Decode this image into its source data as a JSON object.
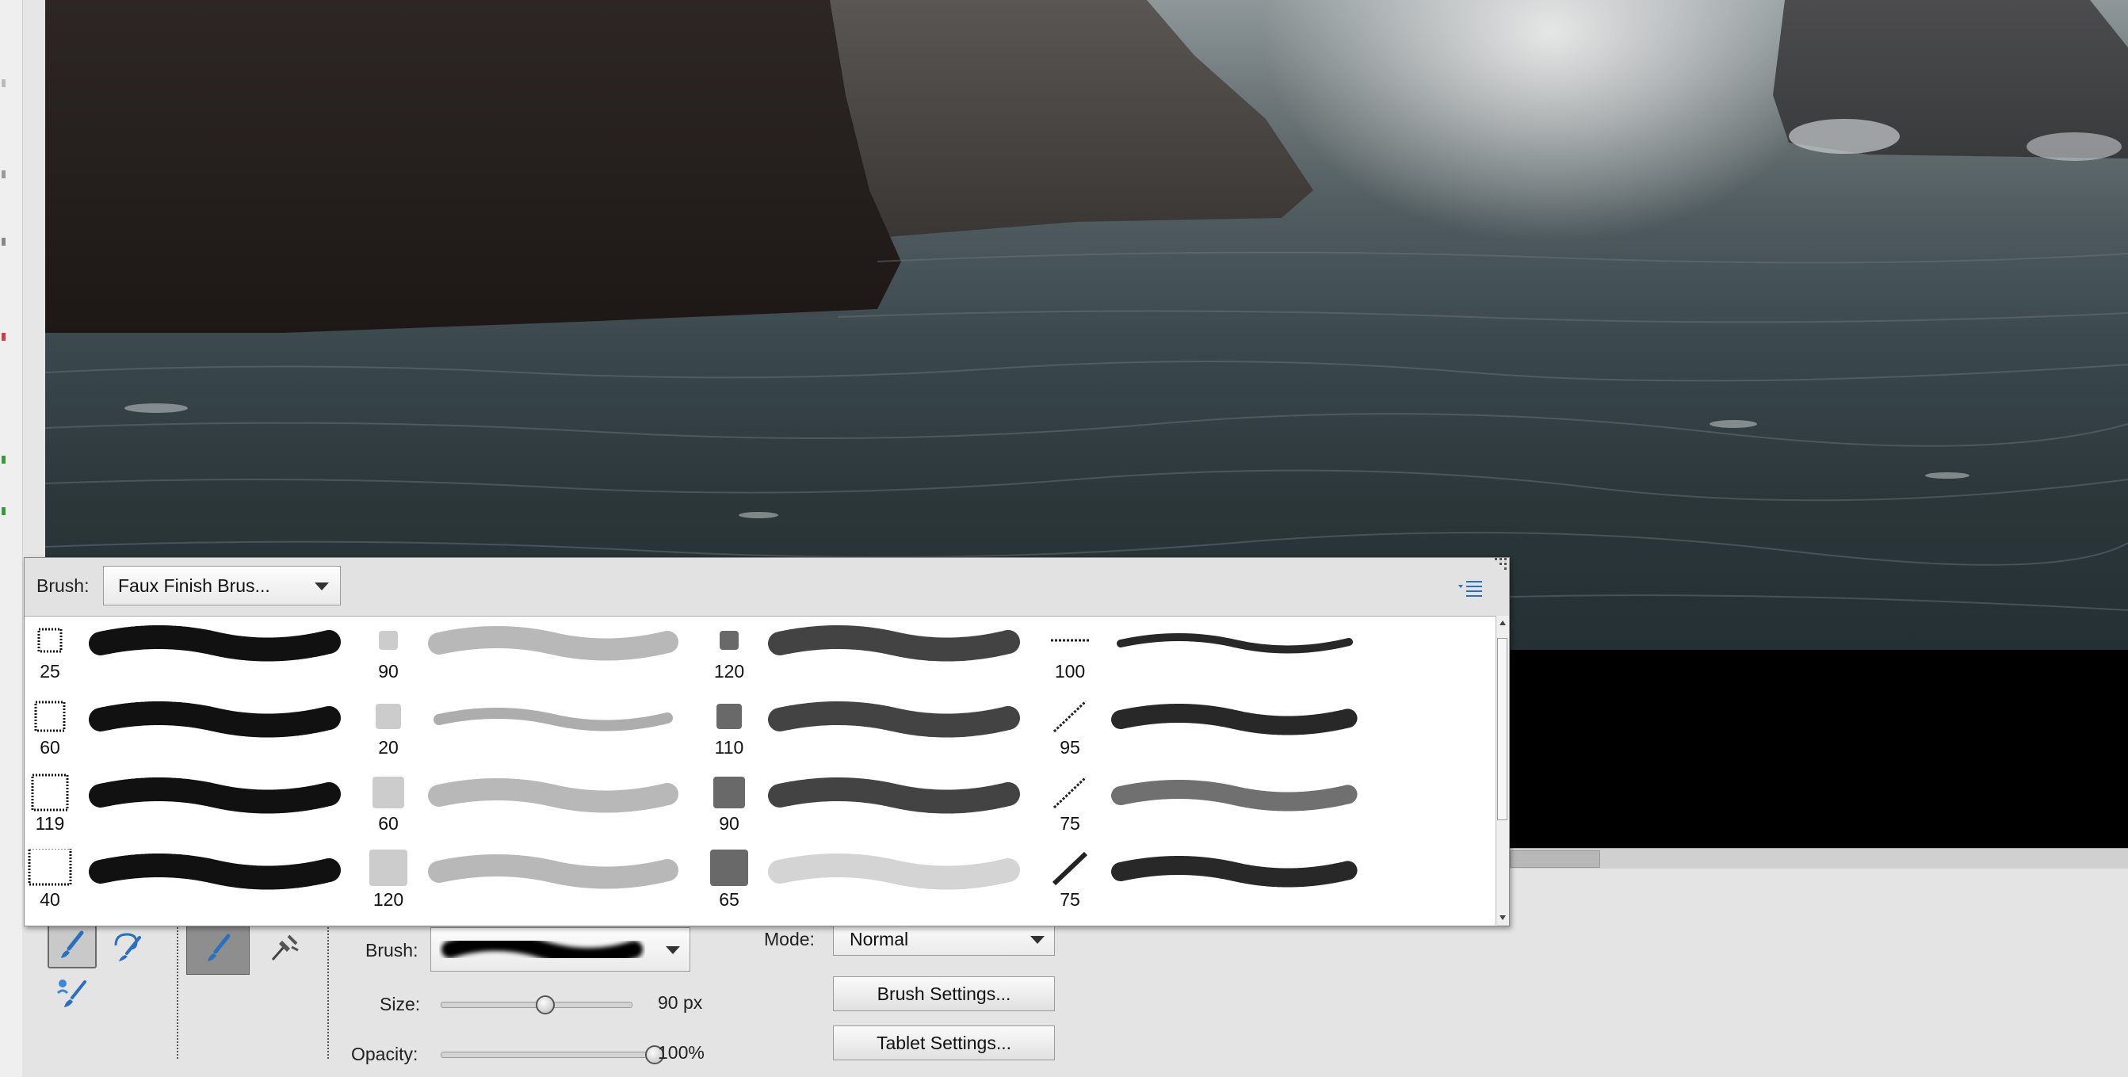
{
  "picker": {
    "brush_label": "Brush:",
    "brush_set": "Faux Finish Brus...",
    "menu_icon": "panel-menu-icon",
    "columns": [
      {
        "sizes": [
          "25",
          "60",
          "119",
          "40"
        ],
        "style": "cross-hatch"
      },
      {
        "sizes": [
          "90",
          "20",
          "60",
          "120"
        ],
        "style": "speckle"
      },
      {
        "sizes": [
          "120",
          "110",
          "90",
          "65"
        ],
        "style": "sponge"
      },
      {
        "sizes": [
          "100",
          "95",
          "75",
          "75"
        ],
        "style": "fiber"
      }
    ]
  },
  "options": {
    "tools": [
      {
        "icon": "brush-tool-icon",
        "selected": true
      },
      {
        "icon": "impressionist-brush-icon",
        "selected": false
      },
      {
        "icon": "color-replacement-brush-icon",
        "selected": false
      }
    ],
    "mode_buttons": [
      {
        "icon": "brush-mode-icon",
        "selected": true
      },
      {
        "icon": "airbrush-icon",
        "selected": false
      }
    ],
    "brush_label": "Brush:",
    "size_label": "Size:",
    "size_value": "90 px",
    "size_fraction": 0.55,
    "opacity_label": "Opacity:",
    "opacity_value": "100%",
    "opacity_fraction": 1.0,
    "mode_label": "Mode:",
    "mode_value": "Normal",
    "brush_settings_label": "Brush Settings...",
    "tablet_settings_label": "Tablet Settings..."
  }
}
